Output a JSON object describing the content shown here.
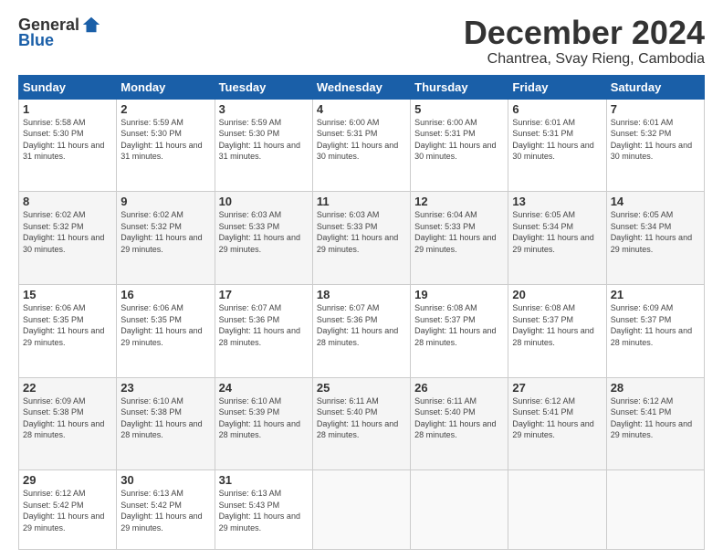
{
  "header": {
    "logo_general": "General",
    "logo_blue": "Blue",
    "title": "December 2024",
    "subtitle": "Chantrea, Svay Rieng, Cambodia"
  },
  "calendar": {
    "days_of_week": [
      "Sunday",
      "Monday",
      "Tuesday",
      "Wednesday",
      "Thursday",
      "Friday",
      "Saturday"
    ],
    "weeks": [
      [
        {
          "num": "",
          "empty": true
        },
        {
          "num": "2",
          "sunrise": "5:59 AM",
          "sunset": "5:30 PM",
          "daylight": "11 hours and 31 minutes."
        },
        {
          "num": "3",
          "sunrise": "5:59 AM",
          "sunset": "5:30 PM",
          "daylight": "11 hours and 31 minutes."
        },
        {
          "num": "4",
          "sunrise": "6:00 AM",
          "sunset": "5:31 PM",
          "daylight": "11 hours and 30 minutes."
        },
        {
          "num": "5",
          "sunrise": "6:00 AM",
          "sunset": "5:31 PM",
          "daylight": "11 hours and 30 minutes."
        },
        {
          "num": "6",
          "sunrise": "6:01 AM",
          "sunset": "5:31 PM",
          "daylight": "11 hours and 30 minutes."
        },
        {
          "num": "7",
          "sunrise": "6:01 AM",
          "sunset": "5:32 PM",
          "daylight": "11 hours and 30 minutes."
        }
      ],
      [
        {
          "num": "1",
          "sunrise": "5:58 AM",
          "sunset": "5:30 PM",
          "daylight": "11 hours and 31 minutes."
        },
        null,
        null,
        null,
        null,
        null,
        null
      ],
      [
        {
          "num": "8",
          "sunrise": "6:02 AM",
          "sunset": "5:32 PM",
          "daylight": "11 hours and 30 minutes."
        },
        {
          "num": "9",
          "sunrise": "6:02 AM",
          "sunset": "5:32 PM",
          "daylight": "11 hours and 29 minutes."
        },
        {
          "num": "10",
          "sunrise": "6:03 AM",
          "sunset": "5:33 PM",
          "daylight": "11 hours and 29 minutes."
        },
        {
          "num": "11",
          "sunrise": "6:03 AM",
          "sunset": "5:33 PM",
          "daylight": "11 hours and 29 minutes."
        },
        {
          "num": "12",
          "sunrise": "6:04 AM",
          "sunset": "5:33 PM",
          "daylight": "11 hours and 29 minutes."
        },
        {
          "num": "13",
          "sunrise": "6:05 AM",
          "sunset": "5:34 PM",
          "daylight": "11 hours and 29 minutes."
        },
        {
          "num": "14",
          "sunrise": "6:05 AM",
          "sunset": "5:34 PM",
          "daylight": "11 hours and 29 minutes."
        }
      ],
      [
        {
          "num": "15",
          "sunrise": "6:06 AM",
          "sunset": "5:35 PM",
          "daylight": "11 hours and 29 minutes."
        },
        {
          "num": "16",
          "sunrise": "6:06 AM",
          "sunset": "5:35 PM",
          "daylight": "11 hours and 29 minutes."
        },
        {
          "num": "17",
          "sunrise": "6:07 AM",
          "sunset": "5:36 PM",
          "daylight": "11 hours and 28 minutes."
        },
        {
          "num": "18",
          "sunrise": "6:07 AM",
          "sunset": "5:36 PM",
          "daylight": "11 hours and 28 minutes."
        },
        {
          "num": "19",
          "sunrise": "6:08 AM",
          "sunset": "5:37 PM",
          "daylight": "11 hours and 28 minutes."
        },
        {
          "num": "20",
          "sunrise": "6:08 AM",
          "sunset": "5:37 PM",
          "daylight": "11 hours and 28 minutes."
        },
        {
          "num": "21",
          "sunrise": "6:09 AM",
          "sunset": "5:37 PM",
          "daylight": "11 hours and 28 minutes."
        }
      ],
      [
        {
          "num": "22",
          "sunrise": "6:09 AM",
          "sunset": "5:38 PM",
          "daylight": "11 hours and 28 minutes."
        },
        {
          "num": "23",
          "sunrise": "6:10 AM",
          "sunset": "5:38 PM",
          "daylight": "11 hours and 28 minutes."
        },
        {
          "num": "24",
          "sunrise": "6:10 AM",
          "sunset": "5:39 PM",
          "daylight": "11 hours and 28 minutes."
        },
        {
          "num": "25",
          "sunrise": "6:11 AM",
          "sunset": "5:40 PM",
          "daylight": "11 hours and 28 minutes."
        },
        {
          "num": "26",
          "sunrise": "6:11 AM",
          "sunset": "5:40 PM",
          "daylight": "11 hours and 28 minutes."
        },
        {
          "num": "27",
          "sunrise": "6:12 AM",
          "sunset": "5:41 PM",
          "daylight": "11 hours and 29 minutes."
        },
        {
          "num": "28",
          "sunrise": "6:12 AM",
          "sunset": "5:41 PM",
          "daylight": "11 hours and 29 minutes."
        }
      ],
      [
        {
          "num": "29",
          "sunrise": "6:12 AM",
          "sunset": "5:42 PM",
          "daylight": "11 hours and 29 minutes."
        },
        {
          "num": "30",
          "sunrise": "6:13 AM",
          "sunset": "5:42 PM",
          "daylight": "11 hours and 29 minutes."
        },
        {
          "num": "31",
          "sunrise": "6:13 AM",
          "sunset": "5:43 PM",
          "daylight": "11 hours and 29 minutes."
        },
        {
          "num": "",
          "empty": true
        },
        {
          "num": "",
          "empty": true
        },
        {
          "num": "",
          "empty": true
        },
        {
          "num": "",
          "empty": true
        }
      ]
    ]
  }
}
